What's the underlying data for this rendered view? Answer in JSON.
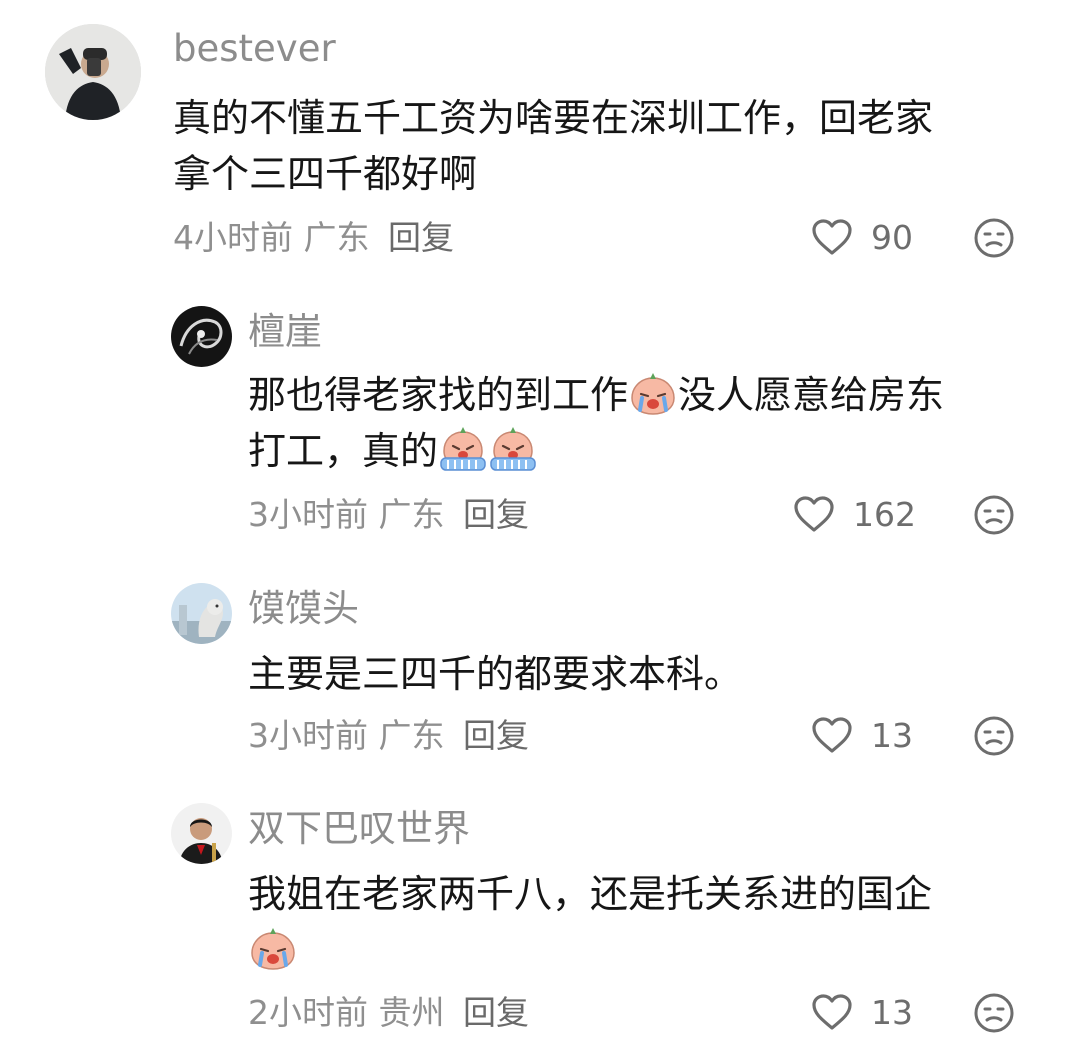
{
  "comments": [
    {
      "username": "bestever",
      "lines": [
        "真的不懂五千工资为啥要在深圳工作，回老家",
        "拿个三四千都好啊"
      ],
      "time": "4小时前",
      "location": "广东",
      "reply_label": "回复",
      "likes": "90"
    },
    {
      "username": "檀崖",
      "line1_a": "那也得老家找的到工作",
      "line1_b": "没人愿意给房东",
      "line2": "打工，真的",
      "time": "3小时前",
      "location": "广东",
      "reply_label": "回复",
      "likes": "162"
    },
    {
      "username": "馍馍头",
      "lines": [
        "主要是三四千的都要求本科。"
      ],
      "time": "3小时前",
      "location": "广东",
      "reply_label": "回复",
      "likes": "13"
    },
    {
      "username": "双下巴叹世界",
      "lines": [
        "我姐在老家两千八，还是托关系进的国企"
      ],
      "time": "2小时前",
      "location": "贵州",
      "reply_label": "回复",
      "likes": "13"
    }
  ],
  "icons": {
    "like": "heart-outline-icon",
    "dislike": "unhappy-face-icon",
    "emoji_crying": "crying-peach-emoji",
    "emoji_sobbing": "sobbing-peach-emoji"
  },
  "colors": {
    "text": "#161616",
    "username": "#8c8c8c",
    "meta": "#8f8f8f",
    "icon": "#6d6d6d",
    "emoji_face": "#f7b9a4",
    "emoji_tears": "#7fb3ee"
  }
}
